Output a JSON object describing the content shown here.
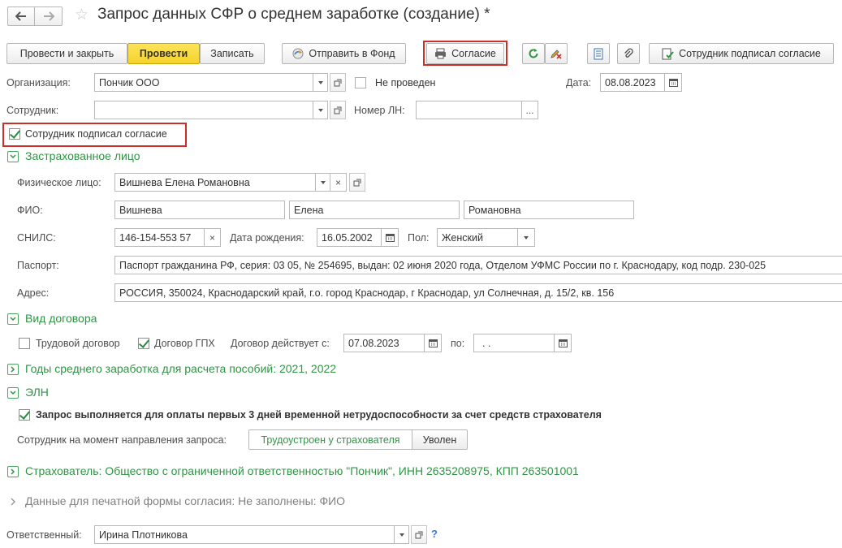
{
  "window": {
    "title": "Запрос данных СФР о среднем заработке (создание) *"
  },
  "toolbar": {
    "post_close": "Провести и закрыть",
    "post": "Провести",
    "save": "Записать",
    "send_fund": "Отправить в Фонд",
    "consent": "Согласие",
    "employee_signed_btn": "Сотрудник подписал согласие"
  },
  "header": {
    "org_label": "Организация:",
    "org_value": "Пончик ООО",
    "not_posted": "Не проведен",
    "date_label": "Дата:",
    "date_value": "08.08.2023",
    "employee_label": "Сотрудник:",
    "employee_value": "",
    "ln_label": "Номер ЛН:",
    "ln_value": "",
    "consent_checkbox": "Сотрудник подписал согласие"
  },
  "insured": {
    "section_title": "Застрахованное лицо",
    "person_label": "Физическое лицо:",
    "person_value": "Вишнева Елена Романовна",
    "fio_label": "ФИО:",
    "last_name": "Вишнева",
    "first_name": "Елена",
    "middle_name": "Романовна",
    "snils_label": "СНИЛС:",
    "snils_value": "146-154-553 57",
    "birth_label": "Дата рождения:",
    "birth_value": "16.05.2002",
    "gender_label": "Пол:",
    "gender_value": "Женский",
    "passport_label": "Паспорт:",
    "passport_value": "Паспорт гражданина РФ, серия: 03 05, № 254695, выдан: 02 июня 2020 года, Отделом УФМС России по г. Краснодару, код подр. 230-025",
    "address_label": "Адрес:",
    "address_value": "РОССИЯ, 350024, Краснодарский край, г.о. город Краснодар, г Краснодар, ул Солнечная, д. 15/2, кв. 156"
  },
  "contract": {
    "section_title": "Вид договора",
    "labor": "Трудовой договор",
    "gph": "Договор ГПХ",
    "valid_from_label": "Договор действует с:",
    "valid_from_value": "07.08.2023",
    "to_label": "по:",
    "to_value": " .  ."
  },
  "years_section": "Годы среднего заработка для расчета пособий: 2021, 2022",
  "eln": {
    "section_title": "ЭЛН",
    "first3days": "Запрос выполняется для оплаты первых 3 дней временной нетрудоспособности за счет средств страхователя",
    "status_label": "Сотрудник на момент направления запроса:",
    "employed": "Трудоустроен у страхователя",
    "fired": "Уволен"
  },
  "insurer_section": "Страхователь: Общество с ограниченной ответственностью \"Пончик\", ИНН 2635208975, КПП 263501001",
  "print_section": "Данные для печатной формы согласия: Не заполнены: ФИО",
  "footer": {
    "responsible_label": "Ответственный:",
    "responsible_value": "Ирина Плотникова",
    "help": "?"
  },
  "colors": {
    "accent_green": "#2f9444",
    "highlight_red": "#c9302c",
    "primary_yellow": "#f5d32c"
  }
}
